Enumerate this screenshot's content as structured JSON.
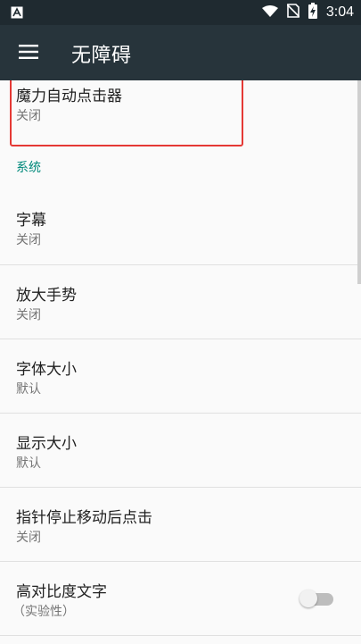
{
  "status_bar": {
    "time": "3:04",
    "icons": [
      "app-notification-icon",
      "wifi-icon",
      "no-sim-icon",
      "battery-charging-icon"
    ]
  },
  "app_bar": {
    "title": "无障碍",
    "menu_icon": "hamburger-menu-icon"
  },
  "items": [
    {
      "title": "魔力自动点击器",
      "summary": "关闭",
      "highlighted": true
    },
    {
      "title": "字幕",
      "summary": "关闭"
    },
    {
      "title": "放大手势",
      "summary": "关闭"
    },
    {
      "title": "字体大小",
      "summary": "默认"
    },
    {
      "title": "显示大小",
      "summary": "默认"
    },
    {
      "title": "指针停止移动后点击",
      "summary": "关闭"
    },
    {
      "title": "高对比度文字",
      "summary": "（实验性）",
      "toggle": false
    }
  ],
  "section_header": "系统",
  "colors": {
    "status_bar": "#1f2a30",
    "app_bar": "#27343b",
    "accent": "#00897b",
    "highlight": "#e53935"
  }
}
